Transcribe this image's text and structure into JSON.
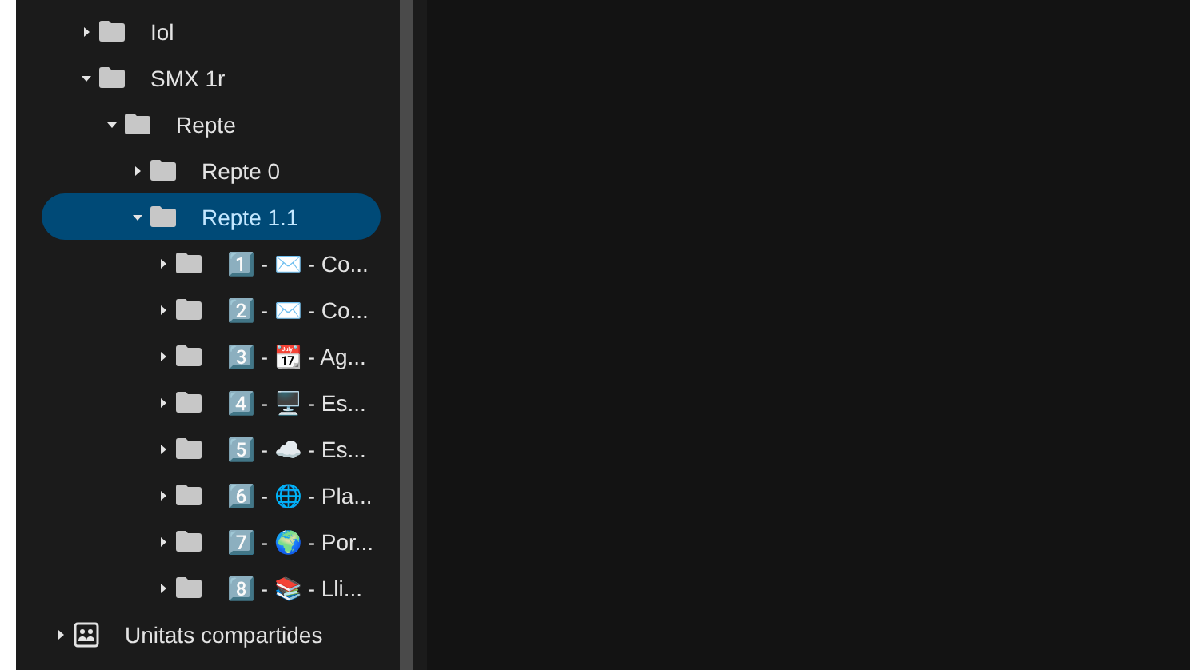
{
  "tree": [
    {
      "label": "Iol",
      "expanded": false,
      "selected": false
    },
    {
      "label": "SMX 1r",
      "expanded": true,
      "selected": false,
      "children": [
        {
          "label": "Repte",
          "expanded": true,
          "selected": false,
          "children": [
            {
              "label": "Repte 0",
              "expanded": false,
              "selected": false
            },
            {
              "label": "Repte 1.1",
              "expanded": true,
              "selected": true,
              "children": [
                {
                  "label": "1️⃣ - ✉️ - Co...",
                  "expanded": false,
                  "selected": false
                },
                {
                  "label": "2️⃣ - ✉️ - Co...",
                  "expanded": false,
                  "selected": false
                },
                {
                  "label": "3️⃣ - 📆 - Ag...",
                  "expanded": false,
                  "selected": false
                },
                {
                  "label": "4️⃣ - 🖥️ - Es...",
                  "expanded": false,
                  "selected": false
                },
                {
                  "label": "5️⃣ - ☁️ - Es...",
                  "expanded": false,
                  "selected": false
                },
                {
                  "label": "6️⃣ - 🌐 - Pla...",
                  "expanded": false,
                  "selected": false
                },
                {
                  "label": "7️⃣ - 🌍 - Por...",
                  "expanded": false,
                  "selected": false
                },
                {
                  "label": "8️⃣ - 📚 - Lli...",
                  "expanded": false,
                  "selected": false
                }
              ]
            }
          ]
        }
      ]
    }
  ],
  "shared_drives": {
    "label": "Unitats compartides",
    "expanded": false,
    "selected": false
  }
}
